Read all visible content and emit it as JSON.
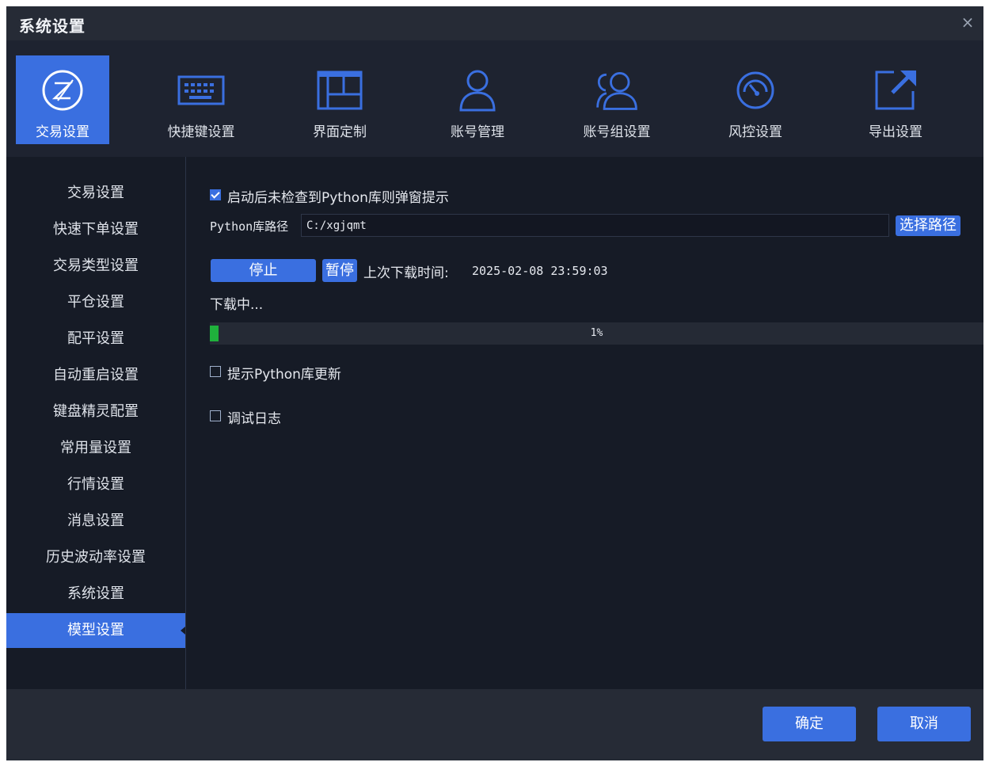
{
  "window": {
    "title": "系统设置",
    "close_glyph": "×"
  },
  "topnav": {
    "items": [
      {
        "label": "交易设置",
        "icon": "trade-circle-icon"
      },
      {
        "label": "快捷键设置",
        "icon": "keyboard-icon"
      },
      {
        "label": "界面定制",
        "icon": "layout-icon"
      },
      {
        "label": "账号管理",
        "icon": "user-icon"
      },
      {
        "label": "账号组设置",
        "icon": "user-group-icon"
      },
      {
        "label": "风控设置",
        "icon": "gauge-icon"
      },
      {
        "label": "导出设置",
        "icon": "export-icon"
      }
    ],
    "active_index": 0
  },
  "sidebar": {
    "items": [
      {
        "label": "交易设置"
      },
      {
        "label": "快速下单设置"
      },
      {
        "label": "交易类型设置"
      },
      {
        "label": "平仓设置"
      },
      {
        "label": "配平设置"
      },
      {
        "label": "自动重启设置"
      },
      {
        "label": "键盘精灵配置"
      },
      {
        "label": "常用量设置"
      },
      {
        "label": "行情设置"
      },
      {
        "label": "消息设置"
      },
      {
        "label": "历史波动率设置"
      },
      {
        "label": "系统设置"
      },
      {
        "label": "模型设置"
      }
    ],
    "active_index": 12
  },
  "model_settings": {
    "popup_checkbox_label": "启动后未检查到Python库则弹窗提示",
    "popup_checked": true,
    "path_label": "Python库路径",
    "path_value": "C:/xgjqmt",
    "choose_path_button": "选择路径",
    "stop_button": "停止",
    "pause_button": "暂停",
    "last_download_label": "上次下载时间:",
    "last_download_time": "2025-02-08 23:59:03",
    "status_text": "下载中...",
    "progress_percent": 1,
    "progress_text": "1%",
    "update_checkbox_label": "提示Python库更新",
    "update_checked": false,
    "debug_checkbox_label": "调试日志",
    "debug_checked": false
  },
  "footer": {
    "confirm": "确定",
    "cancel": "取消"
  },
  "colors": {
    "accent": "#3a6fe0",
    "progress": "#1fb13c",
    "background": "#161b26"
  }
}
